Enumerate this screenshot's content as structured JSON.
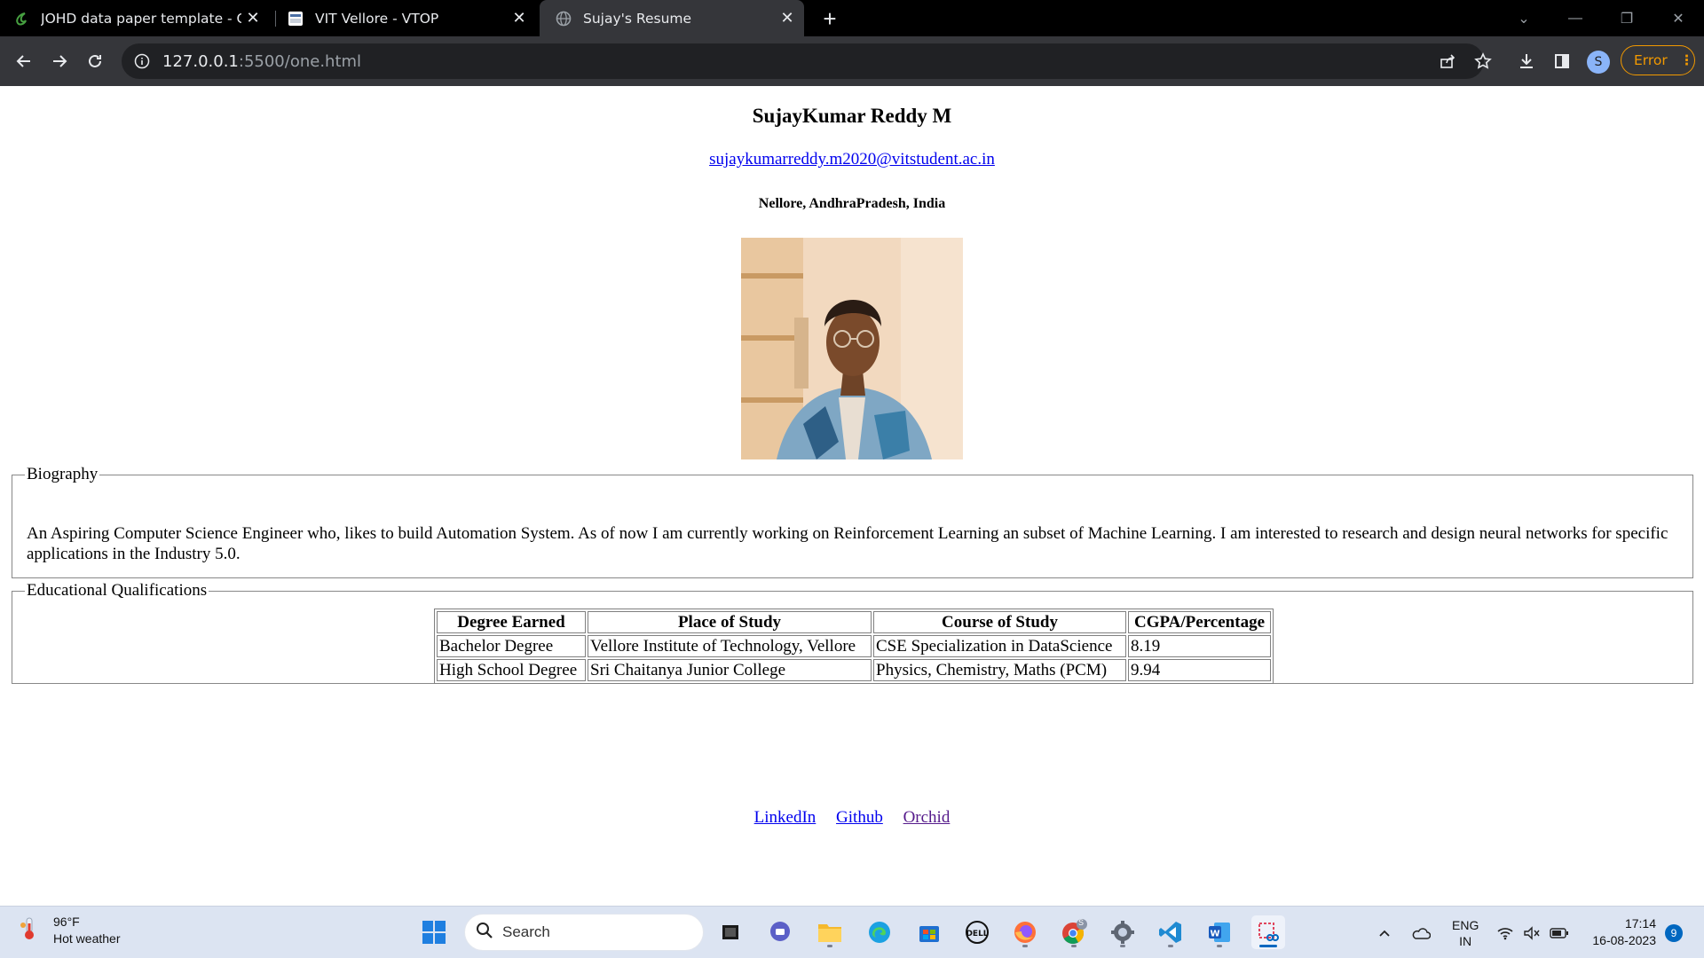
{
  "browser": {
    "tabs": [
      {
        "title": "JOHD data paper template - Onl",
        "icon": "overleaf-icon"
      },
      {
        "title": "VIT Vellore - VTOP",
        "icon": "vtop-icon"
      },
      {
        "title": "Sujay's Resume",
        "icon": "globe-icon",
        "active": true
      }
    ],
    "url_host": "127.0.0.1",
    "url_rest": ":5500/one.html",
    "profile_initial": "S",
    "error_label": "Error",
    "accent_error": "#f29900"
  },
  "resume": {
    "name": "SujayKumar Reddy M",
    "email": "sujaykumarreddy.m2020@vitstudent.ac.in",
    "location": "Nellore, AndhraPradesh, India",
    "biography_legend": "Biography",
    "biography_text": "An Aspiring Computer Science Engineer who, likes to build Automation System. As of now I am currently working on Reinforcement Learning an subset of Machine Learning. I am interested to research and design neural networks for specific applications in the Industry 5.0.",
    "education_legend": "Educational Qualifications",
    "table": {
      "headers": [
        "Degree Earned",
        "Place of Study",
        "Course of Study",
        "CGPA/Percentage"
      ],
      "rows": [
        [
          "Bachelor Degree",
          "Vellore Institute of Technology, Vellore",
          "CSE Specialization in DataScience",
          "8.19"
        ],
        [
          "High School Degree",
          "Sri Chaitanya Junior College",
          "Physics, Chemistry, Maths (PCM)",
          "9.94"
        ]
      ]
    },
    "links": [
      "LinkedIn",
      "Github",
      "Orchid"
    ]
  },
  "taskbar": {
    "weather_temp": "96°F",
    "weather_desc": "Hot weather",
    "search_label": "Search",
    "lang_top": "ENG",
    "lang_bottom": "IN",
    "time": "17:14",
    "date": "16-08-2023",
    "notifications": "9",
    "chrome_badge": "S"
  }
}
